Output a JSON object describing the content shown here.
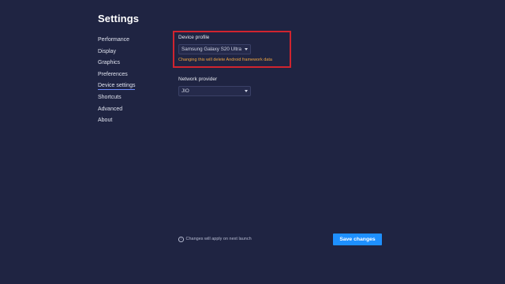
{
  "header": {
    "title": "Settings"
  },
  "sidebar": {
    "items": [
      {
        "label": "Performance"
      },
      {
        "label": "Display"
      },
      {
        "label": "Graphics"
      },
      {
        "label": "Preferences"
      },
      {
        "label": "Device settings",
        "active": true
      },
      {
        "label": "Shortcuts"
      },
      {
        "label": "Advanced"
      },
      {
        "label": "About"
      }
    ]
  },
  "device_profile": {
    "label": "Device profile",
    "selected": "Samsung Galaxy S20 Ultra",
    "warning": "Changing this will delete Android framework data"
  },
  "network_provider": {
    "label": "Network provider",
    "selected": "JIO"
  },
  "footer": {
    "note": "Changes will apply on next launch",
    "save_label": "Save changes"
  },
  "colors": {
    "background": "#1f2442",
    "accent": "#1e90ff",
    "warning": "#f0a540",
    "highlight": "#d0242f"
  }
}
